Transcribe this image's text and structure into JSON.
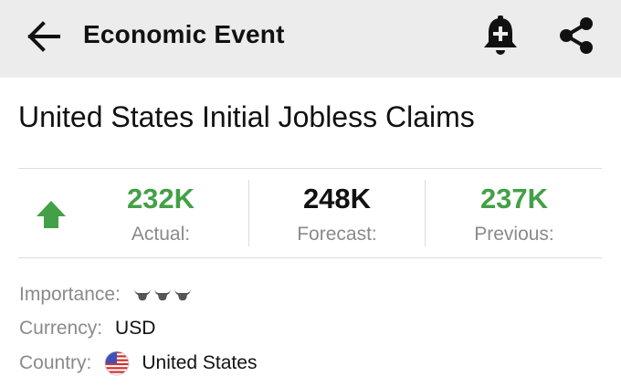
{
  "appbar": {
    "title": "Economic Event",
    "back_icon": "arrow-left-icon",
    "alert_icon": "bell-plus-icon",
    "share_icon": "share-icon"
  },
  "event": {
    "title": "United States Initial Jobless Claims",
    "trend_icon": "arrow-up-icon",
    "trend_color": "#43a047"
  },
  "stats": {
    "actual": {
      "value": "232K",
      "label": "Actual:",
      "color": "#43a047"
    },
    "forecast": {
      "value": "248K",
      "label": "Forecast:",
      "color": "#111111"
    },
    "previous": {
      "value": "237K",
      "label": "Previous:",
      "color": "#43a047"
    }
  },
  "details": {
    "importance": {
      "label": "Importance:",
      "level": 3,
      "max": 3,
      "icon": "bull-icon"
    },
    "currency": {
      "label": "Currency:",
      "value": "USD"
    },
    "country": {
      "label": "Country:",
      "value": "United States",
      "flag_icon": "us-flag-icon"
    }
  }
}
